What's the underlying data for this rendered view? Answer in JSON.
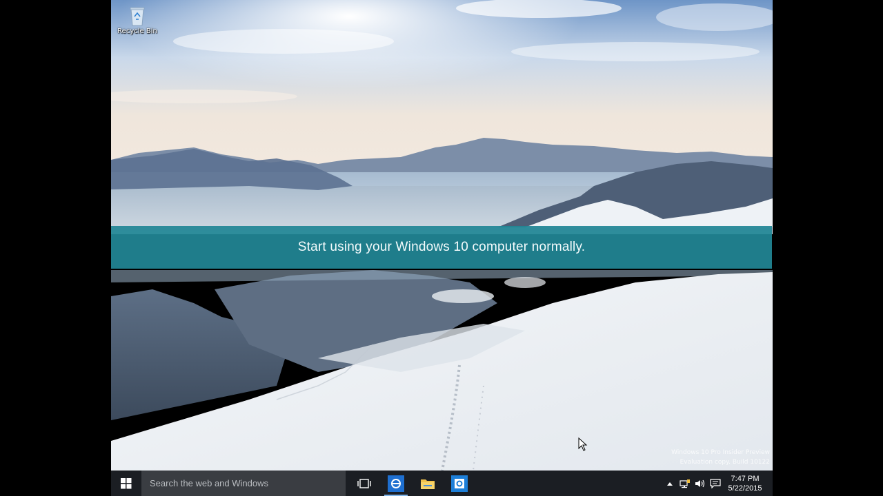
{
  "desktop": {
    "recycle_bin_label": "Recycle Bin",
    "recycle_bin_icon": "recycle-bin-icon"
  },
  "banner": {
    "text": "Start using your Windows 10 computer normally.",
    "color": "#218696"
  },
  "watermark": {
    "line1": "Windows 10 Pro Insider Preview",
    "line2": "Evaluation copy. Build 10122"
  },
  "taskbar": {
    "search_placeholder": "Search the web and Windows",
    "apps": [
      {
        "name": "task-view",
        "icon": "task-view-icon"
      },
      {
        "name": "ie",
        "icon": "internet-explorer-icon",
        "active": true
      },
      {
        "name": "file-explorer",
        "icon": "folder-icon"
      },
      {
        "name": "outlook",
        "icon": "outlook-icon"
      }
    ],
    "clock": {
      "time": "7:47 PM",
      "date": "5/22/2015"
    }
  },
  "colors": {
    "taskbar_bg": "#1b1e23",
    "search_bg": "#3a3d42",
    "accent": "#0078d7"
  }
}
